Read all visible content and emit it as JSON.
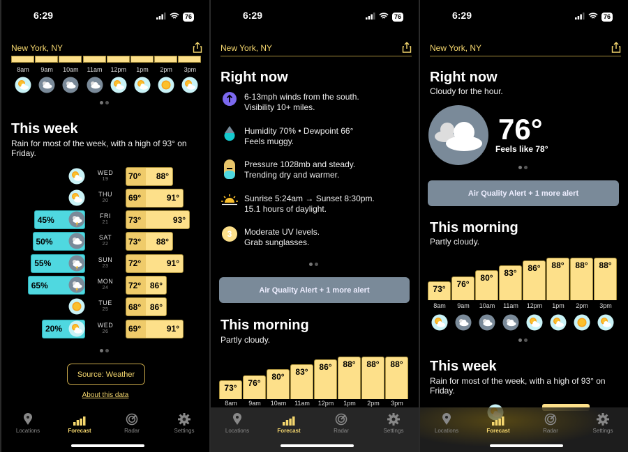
{
  "status": {
    "time": "6:29",
    "battery": "76"
  },
  "location": "New York, NY",
  "hourly": {
    "hours": [
      "8am",
      "9am",
      "10am",
      "11am",
      "12pm",
      "1pm",
      "2pm",
      "3pm"
    ],
    "temps": [
      73,
      76,
      80,
      83,
      86,
      88,
      88,
      88
    ],
    "icons": [
      "partly-cloudy",
      "cloudy",
      "cloudy",
      "cloudy",
      "partly-cloudy",
      "partly-cloudy",
      "sunny",
      "partly-cloudy"
    ]
  },
  "week": {
    "title": "This week",
    "summary": "Rain for most of the week, with a high of 93° on Friday.",
    "days": [
      {
        "day": "WED",
        "date": "19",
        "low": "70°",
        "high": "88°",
        "precip": "",
        "icon": "partly-cloudy"
      },
      {
        "day": "THU",
        "date": "20",
        "low": "69°",
        "high": "91°",
        "precip": "",
        "icon": "partly-cloudy"
      },
      {
        "day": "FRI",
        "date": "21",
        "low": "73°",
        "high": "93°",
        "precip": "45%",
        "icon": "thunderstorm"
      },
      {
        "day": "SAT",
        "date": "22",
        "low": "73°",
        "high": "88°",
        "precip": "50%",
        "icon": "cloudy"
      },
      {
        "day": "SUN",
        "date": "23",
        "low": "72°",
        "high": "91°",
        "precip": "55%",
        "icon": "thunderstorm"
      },
      {
        "day": "MON",
        "date": "24",
        "low": "72°",
        "high": "86°",
        "precip": "65%",
        "icon": "thunderstorm"
      },
      {
        "day": "TUE",
        "date": "25",
        "low": "68°",
        "high": "86°",
        "precip": "",
        "icon": "sunny"
      },
      {
        "day": "WED",
        "date": "26",
        "low": "69°",
        "high": "91°",
        "precip": "20%",
        "icon": "partly-cloudy"
      }
    ],
    "precip_pct": [
      0,
      0,
      45,
      50,
      55,
      65,
      0,
      20
    ]
  },
  "source": {
    "label": "Source:  Weather",
    "about": "About this data"
  },
  "right_now": {
    "title": "Right now",
    "summary": "Cloudy for the hour.",
    "temp": "76°",
    "feels_like": "Feels like 78°",
    "icon": "cloudy",
    "items": [
      {
        "icon": "wind-arrow-icon",
        "line1": "6-13mph winds from the south.",
        "line2": "Visibility 10+ miles."
      },
      {
        "icon": "humidity-drop-icon",
        "line1": "Humidity 70% • Dewpoint 66°",
        "line2": "Feels muggy."
      },
      {
        "icon": "pressure-gauge-icon",
        "line1": "Pressure 1028mb and steady.",
        "line2": "Trending dry and warmer."
      },
      {
        "icon": "sunrise-icon",
        "line1": "Sunrise 5:24am → Sunset 8:30pm.",
        "line2": "15.1 hours of daylight."
      },
      {
        "icon": "uv-index-icon",
        "uv": "3",
        "line1": "Moderate UV levels.",
        "line2": "Grab sunglasses."
      }
    ]
  },
  "alert": "Air Quality Alert + 1 more alert",
  "morning": {
    "title": "This morning",
    "summary": "Partly cloudy."
  },
  "tabs": [
    {
      "label": "Locations",
      "icon": "location-pin-icon"
    },
    {
      "label": "Forecast",
      "icon": "forecast-bars-icon",
      "active": true
    },
    {
      "label": "Radar",
      "icon": "radar-icon"
    },
    {
      "label": "Settings",
      "icon": "gear-icon"
    }
  ],
  "colors": {
    "accent": "#f5d76e",
    "bar": "#fde08a",
    "precip": "#4fd8e0",
    "alert": "#7a8a99",
    "uv": "#fde08a",
    "wind": "#7b68ee"
  }
}
